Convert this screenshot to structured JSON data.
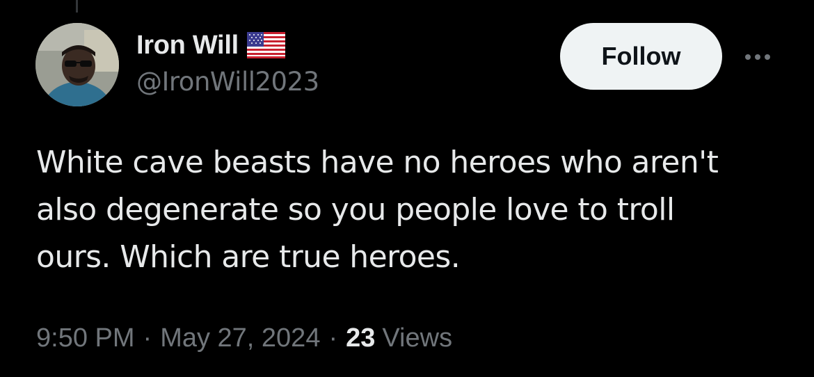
{
  "post": {
    "author": {
      "display_name": "Iron Will",
      "handle": "@IronWill2023",
      "badge_icon": "us-flag-icon",
      "avatar_icon": "profile-photo-avatar"
    },
    "follow_label": "Follow",
    "more_icon": "more-options-icon",
    "text_lines": [
      "White cave beasts have no heroes who aren't",
      "also degenerate so you people love to troll",
      "ours. Which are true heroes."
    ],
    "time": "9:50 PM",
    "date": "May 27, 2024",
    "separator": "·",
    "views_count": "23",
    "views_label": "Views"
  },
  "colors": {
    "background": "#000000",
    "primary_text": "#e7e9ea",
    "secondary_text": "#71767b",
    "follow_bg": "#eff3f4",
    "follow_text": "#0f1419"
  }
}
